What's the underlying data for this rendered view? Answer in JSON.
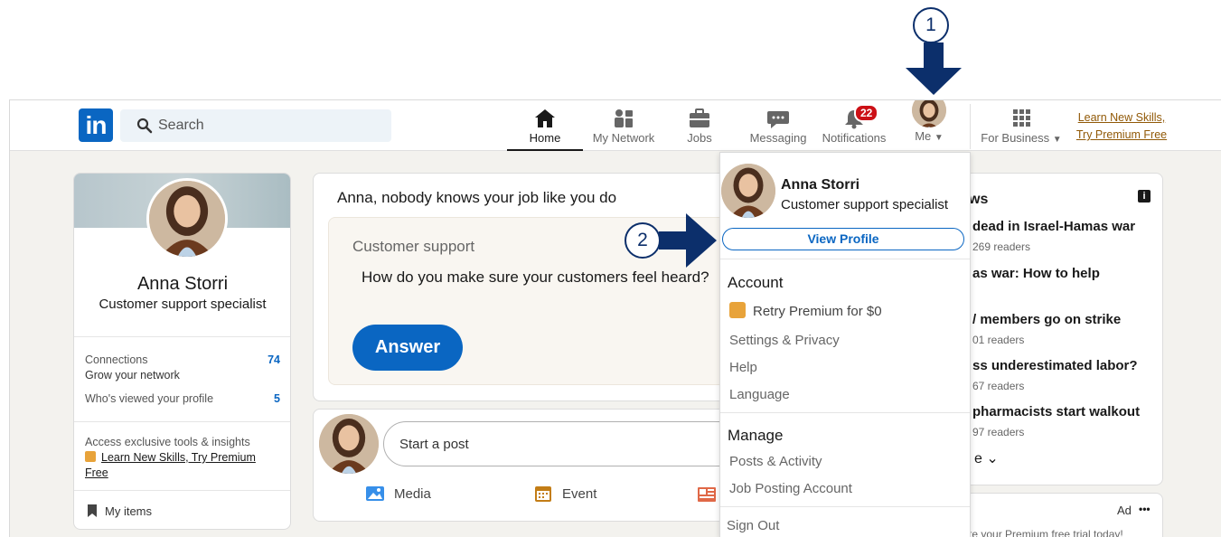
{
  "nav": {
    "search_placeholder": "Search",
    "home": "Home",
    "network": "My Network",
    "jobs": "Jobs",
    "messaging": "Messaging",
    "notifications": "Notifications",
    "notifications_count": "22",
    "me": "Me",
    "for_business": "For Business",
    "premium_line1": "Learn New Skills,",
    "premium_line2": "Try Premium Free"
  },
  "profile": {
    "name": "Anna Storri",
    "headline": "Customer support specialist",
    "connections_label": "Connections",
    "connections_count": "74",
    "grow_label": "Grow your network",
    "viewed_label": "Who's viewed your profile",
    "viewed_count": "5",
    "premium_note": "Access exclusive tools & insights",
    "premium_link": "Learn New Skills, Try Premium Free",
    "my_items": "My items"
  },
  "feed": {
    "prompt": "Anna, nobody knows your job like you do",
    "category": "Customer support",
    "question": "How do you make sure your customers feel heard?",
    "answer_label": "Answer",
    "start_post": "Start a post",
    "media_label": "Media",
    "event_label": "Event"
  },
  "dropdown": {
    "name": "Anna Storri",
    "headline": "Customer support specialist",
    "view_profile": "View Profile",
    "account_title": "Account",
    "retry_premium": "Retry Premium for $0",
    "settings": "Settings & Privacy",
    "help": "Help",
    "language": "Language",
    "manage_title": "Manage",
    "posts_activity": "Posts & Activity",
    "job_posting": "Job Posting Account",
    "sign_out": "Sign Out"
  },
  "news": {
    "title_fragment": "ws",
    "items": [
      {
        "title": "dead in Israel-Hamas war",
        "sub": "269 readers"
      },
      {
        "title": "as war: How to help",
        "sub": ""
      },
      {
        "title": "/ members go on strike",
        "sub": "01 readers"
      },
      {
        "title": "ss underestimated labor?",
        "sub": "67 readers"
      },
      {
        "title": "pharmacists start walkout",
        "sub": "97 readers"
      }
    ],
    "ad_label": "Ad",
    "ad_more": "•••",
    "ad_text": "te your Premium free trial today!"
  },
  "callouts": {
    "one": "1",
    "two": "2"
  },
  "colors": {
    "brand": "#0a66c2",
    "premium": "#915907",
    "callout": "#0c2f6b",
    "badge": "#cc1016"
  }
}
